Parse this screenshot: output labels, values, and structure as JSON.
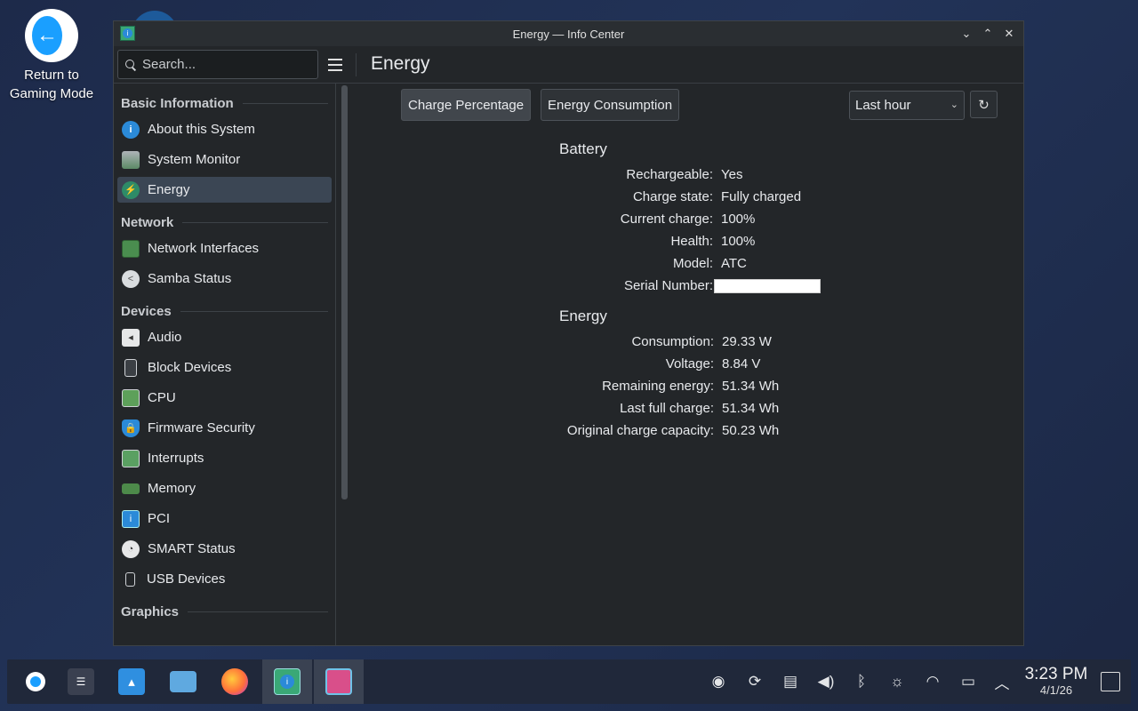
{
  "desktop": {
    "return_label_line1": "Return to",
    "return_label_line2": "Gaming Mode"
  },
  "window": {
    "title": "Energy — Info Center"
  },
  "search": {
    "placeholder": "Search..."
  },
  "page_title": "Energy",
  "sidebar": {
    "sections": [
      {
        "title": "Basic Information",
        "items": [
          "About this System",
          "System Monitor",
          "Energy"
        ]
      },
      {
        "title": "Network",
        "items": [
          "Network Interfaces",
          "Samba Status"
        ]
      },
      {
        "title": "Devices",
        "items": [
          "Audio",
          "Block Devices",
          "CPU",
          "Firmware Security",
          "Interrupts",
          "Memory",
          "PCI",
          "SMART Status",
          "USB Devices"
        ]
      },
      {
        "title": "Graphics",
        "items": []
      }
    ],
    "active_item": "Energy"
  },
  "toolbar": {
    "tab_charge": "Charge Percentage",
    "tab_consumption": "Energy Consumption",
    "range_selected": "Last hour"
  },
  "battery": {
    "heading": "Battery",
    "rows": [
      {
        "label": "Rechargeable:",
        "value": "Yes"
      },
      {
        "label": "Charge state:",
        "value": "Fully charged"
      },
      {
        "label": "Current charge:",
        "value": "100%"
      },
      {
        "label": "Health:",
        "value": "100%"
      },
      {
        "label": "Model:",
        "value": "ATC"
      },
      {
        "label": "Serial Number:",
        "value": ""
      }
    ]
  },
  "energy": {
    "heading": "Energy",
    "rows": [
      {
        "label": "Consumption:",
        "value": "29.33 W"
      },
      {
        "label": "Voltage:",
        "value": "8.84 V"
      },
      {
        "label": "Remaining energy:",
        "value": "51.34 Wh"
      },
      {
        "label": "Last full charge:",
        "value": "51.34 Wh"
      },
      {
        "label": "Original charge capacity:",
        "value": "50.23 Wh"
      }
    ]
  },
  "taskbar": {
    "time": "3:23 PM",
    "date": "4/1/26"
  },
  "colors": {
    "accent": "#3daee9",
    "window_bg": "#232629",
    "active_item_bg": "#3b4654"
  }
}
